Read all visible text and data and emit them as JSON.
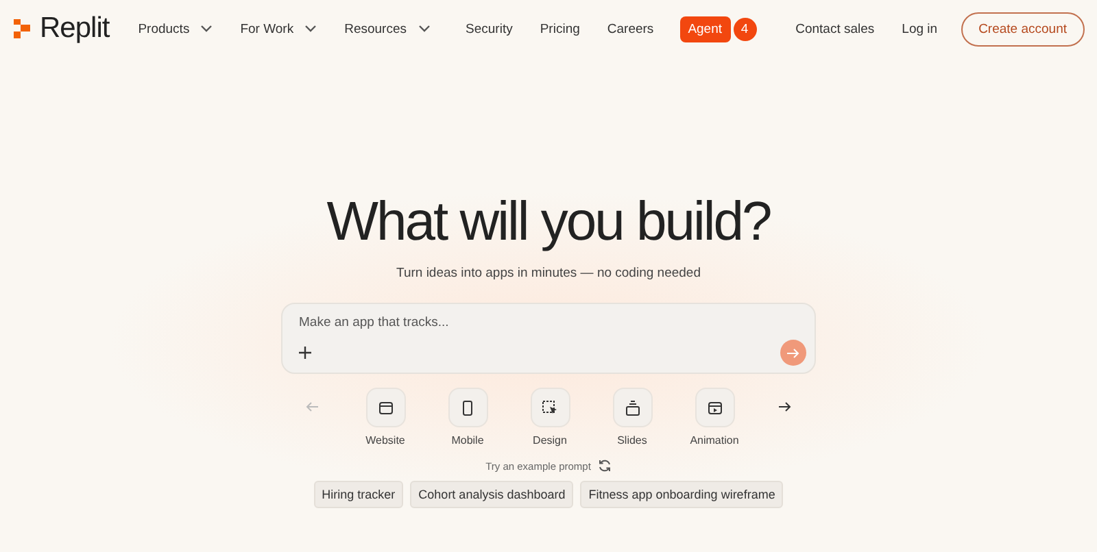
{
  "logo": {
    "text": "Replit"
  },
  "nav": [
    {
      "label": "Products",
      "has_menu": true
    },
    {
      "label": "For Work",
      "has_menu": true
    },
    {
      "label": "Resources",
      "has_menu": true
    },
    {
      "label": "Security",
      "has_menu": false
    },
    {
      "label": "Pricing",
      "has_menu": false
    },
    {
      "label": "Careers",
      "has_menu": false
    }
  ],
  "agent": {
    "label": "Agent",
    "badge": "4"
  },
  "actions": {
    "contact": "Contact sales",
    "login": "Log in",
    "create": "Create account"
  },
  "hero": {
    "title": "What will you build?",
    "subtitle": "Turn ideas into apps in minutes — no coding needed"
  },
  "prompt": {
    "placeholder": "Make an app that tracks..."
  },
  "carousel": {
    "prev_disabled": true,
    "next_disabled": false
  },
  "categories": [
    {
      "kind": "website",
      "label": "Website"
    },
    {
      "kind": "mobile",
      "label": "Mobile"
    },
    {
      "kind": "design",
      "label": "Design"
    },
    {
      "kind": "slides",
      "label": "Slides"
    },
    {
      "kind": "animation",
      "label": "Animation"
    }
  ],
  "examples": {
    "label": "Try an example prompt",
    "chips": [
      "Hiring tracker",
      "Cohort analysis dashboard",
      "Fitness app onboarding wireframe"
    ]
  }
}
